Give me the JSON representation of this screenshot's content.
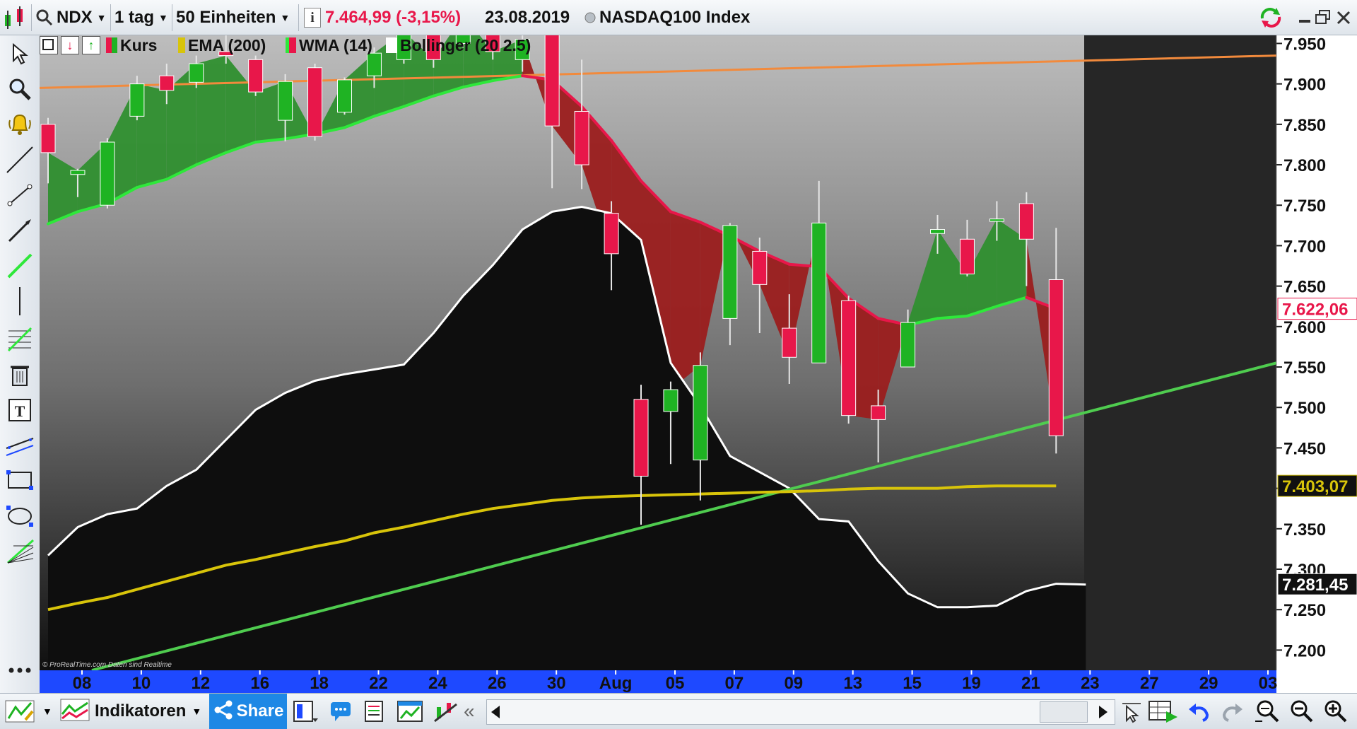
{
  "topbar": {
    "symbol": "NDX",
    "timeframe": "1 tag",
    "units": "50 Einheiten",
    "price_change": "7.464,99 (-3,15%)",
    "date": "23.08.2019",
    "instrument_name": "NASDAQ100 Index",
    "info_label": "i"
  },
  "legend": {
    "kurs": "Kurs",
    "ema": "EMA (200)",
    "wma": "WMA (14)",
    "bollinger": "Bollinger (20 2.5)"
  },
  "watermark": "© ProRealTime.com  Daten sind Realtime",
  "bottombar": {
    "indicators_label": "Indikatoren",
    "share_label": "Share"
  },
  "colors": {
    "up": "#1fb323",
    "down": "#e8174a",
    "ema": "#d8c40a",
    "wma_up": "#2ee83a",
    "wma_down": "#e8174a",
    "bollinger": "#ffffff",
    "ema_long": "#f28a3c",
    "trendline": "#4fcc4f",
    "axis_bg": "#1e49ff"
  },
  "icons": [
    "candlestick-icon",
    "arrow-cursor-icon",
    "zoom-icon",
    "bell-icon",
    "line-icon",
    "segment-icon",
    "arrow-line-icon",
    "trend-line-icon",
    "vertical-line-icon",
    "fibonacci-icon",
    "trash-icon",
    "text-icon",
    "channel-icon",
    "rectangle-icon",
    "ellipse-icon",
    "fan-icon",
    "more-icon"
  ],
  "chart_data": {
    "type": "candlestick",
    "title": "NASDAQ100 Index",
    "x_tick_labels": [
      "08",
      "10",
      "12",
      "16",
      "18",
      "22",
      "24",
      "26",
      "30",
      "Aug",
      "05",
      "07",
      "09",
      "13",
      "15",
      "19",
      "21",
      "23",
      "27",
      "29",
      "03"
    ],
    "y_tick_labels": [
      "7.950",
      "7.900",
      "7.850",
      "7.800",
      "7.750",
      "7.700",
      "7.650",
      "7.600",
      "7.550",
      "7.500",
      "7.450",
      "7.400",
      "7.350",
      "7.300",
      "7.250",
      "7.200"
    ],
    "ylim": [
      7175,
      7960
    ],
    "price_tags": [
      {
        "label": "7.622,06",
        "value": 7622.06,
        "series": "WMA (14)"
      },
      {
        "label": "7.403,07",
        "value": 7403.07,
        "series": "EMA (200)"
      },
      {
        "label": "7.281,45",
        "value": 7281.45,
        "series": "Bollinger (20 2.5)"
      }
    ],
    "candles": [
      {
        "date": "2019-07-08",
        "open": 7850,
        "high": 7858,
        "low": 7777,
        "close": 7815
      },
      {
        "date": "2019-07-09",
        "open": 7788,
        "high": 7795,
        "low": 7760,
        "close": 7793
      },
      {
        "date": "2019-07-10",
        "open": 7750,
        "high": 7833,
        "low": 7746,
        "close": 7828
      },
      {
        "date": "2019-07-11",
        "open": 7860,
        "high": 7910,
        "low": 7855,
        "close": 7900
      },
      {
        "date": "2019-07-12",
        "open": 7910,
        "high": 7925,
        "low": 7875,
        "close": 7892
      },
      {
        "date": "2019-07-15",
        "open": 7902,
        "high": 7935,
        "low": 7895,
        "close": 7925
      },
      {
        "date": "2019-07-16",
        "open": 7940,
        "high": 7960,
        "low": 7925,
        "close": 7935
      },
      {
        "date": "2019-07-17",
        "open": 7930,
        "high": 7935,
        "low": 7885,
        "close": 7890
      },
      {
        "date": "2019-07-18",
        "open": 7855,
        "high": 7912,
        "low": 7829,
        "close": 7903
      },
      {
        "date": "2019-07-19",
        "open": 7920,
        "high": 7925,
        "low": 7830,
        "close": 7835
      },
      {
        "date": "2019-07-22",
        "open": 7865,
        "high": 7908,
        "low": 7862,
        "close": 7905
      },
      {
        "date": "2019-07-23",
        "open": 7910,
        "high": 7945,
        "low": 7895,
        "close": 7938
      },
      {
        "date": "2019-07-24",
        "open": 7930,
        "high": 7975,
        "low": 7925,
        "close": 7965
      },
      {
        "date": "2019-07-25",
        "open": 7965,
        "high": 7972,
        "low": 7920,
        "close": 7930
      },
      {
        "date": "2019-07-26",
        "open": 7950,
        "high": 7990,
        "low": 7945,
        "close": 7985
      },
      {
        "date": "2019-07-29",
        "open": 7980,
        "high": 7990,
        "low": 7930,
        "close": 7940
      },
      {
        "date": "2019-07-30",
        "open": 7930,
        "high": 7960,
        "low": 7915,
        "close": 7955
      },
      {
        "date": "2019-07-31",
        "open": 7980,
        "high": 7990,
        "low": 7771,
        "close": 7848
      },
      {
        "date": "2019-08-01",
        "open": 7866,
        "high": 7930,
        "low": 7770,
        "close": 7800
      },
      {
        "date": "2019-08-02",
        "open": 7740,
        "high": 7755,
        "low": 7645,
        "close": 7690
      },
      {
        "date": "2019-08-05",
        "open": 7510,
        "high": 7528,
        "low": 7355,
        "close": 7415
      },
      {
        "date": "2019-08-06",
        "open": 7495,
        "high": 7532,
        "low": 7430,
        "close": 7522
      },
      {
        "date": "2019-08-07",
        "open": 7435,
        "high": 7568,
        "low": 7385,
        "close": 7552
      },
      {
        "date": "2019-08-08",
        "open": 7610,
        "high": 7728,
        "low": 7577,
        "close": 7725
      },
      {
        "date": "2019-08-09",
        "open": 7693,
        "high": 7710,
        "low": 7592,
        "close": 7652
      },
      {
        "date": "2019-08-12",
        "open": 7598,
        "high": 7640,
        "low": 7529,
        "close": 7562
      },
      {
        "date": "2019-08-13",
        "open": 7555,
        "high": 7780,
        "low": 7555,
        "close": 7728
      },
      {
        "date": "2019-08-14",
        "open": 7632,
        "high": 7638,
        "low": 7480,
        "close": 7490
      },
      {
        "date": "2019-08-15",
        "open": 7502,
        "high": 7522,
        "low": 7432,
        "close": 7485
      },
      {
        "date": "2019-08-16",
        "open": 7550,
        "high": 7621,
        "low": 7550,
        "close": 7605
      },
      {
        "date": "2019-08-19",
        "open": 7715,
        "high": 7738,
        "low": 7690,
        "close": 7720
      },
      {
        "date": "2019-08-20",
        "open": 7708,
        "high": 7732,
        "low": 7662,
        "close": 7665
      },
      {
        "date": "2019-08-21",
        "open": 7730,
        "high": 7755,
        "low": 7706,
        "close": 7733
      },
      {
        "date": "2019-08-22",
        "open": 7752,
        "high": 7766,
        "low": 7650,
        "close": 7708
      },
      {
        "date": "2019-08-23",
        "open": 7658,
        "high": 7722,
        "low": 7443,
        "close": 7465
      }
    ],
    "series": [
      {
        "name": "EMA (200)",
        "values": [
          7250,
          7258,
          7265,
          7275,
          7285,
          7295,
          7305,
          7312,
          7320,
          7328,
          7335,
          7345,
          7352,
          7360,
          7368,
          7375,
          7380,
          7385,
          7388,
          7390,
          7391,
          7392,
          7393,
          7394,
          7395,
          7396,
          7397,
          7399,
          7400,
          7400,
          7400,
          7402,
          7403,
          7403,
          7403
        ]
      },
      {
        "name": "WMA (14)",
        "values": [
          7727,
          7742,
          7752,
          7772,
          7782,
          7800,
          7815,
          7828,
          7832,
          7838,
          7846,
          7860,
          7872,
          7885,
          7896,
          7904,
          7910,
          7905,
          7872,
          7830,
          7780,
          7742,
          7729,
          7712,
          7693,
          7677,
          7674,
          7635,
          7610,
          7602,
          7610,
          7613,
          7625,
          7636,
          7622
        ]
      },
      {
        "name": "Bollinger (20 2.5)",
        "values": [
          7317,
          7352,
          7368,
          7375,
          7403,
          7423,
          7460,
          7497,
          7518,
          7533,
          7541,
          7547,
          7553,
          7592,
          7638,
          7676,
          7720,
          7742,
          7748,
          7740,
          7707,
          7555,
          7502,
          7440,
          7420,
          7400,
          7362,
          7359,
          7310,
          7270,
          7253,
          7253,
          7255,
          7273,
          7282,
          7281
        ]
      }
    ]
  }
}
